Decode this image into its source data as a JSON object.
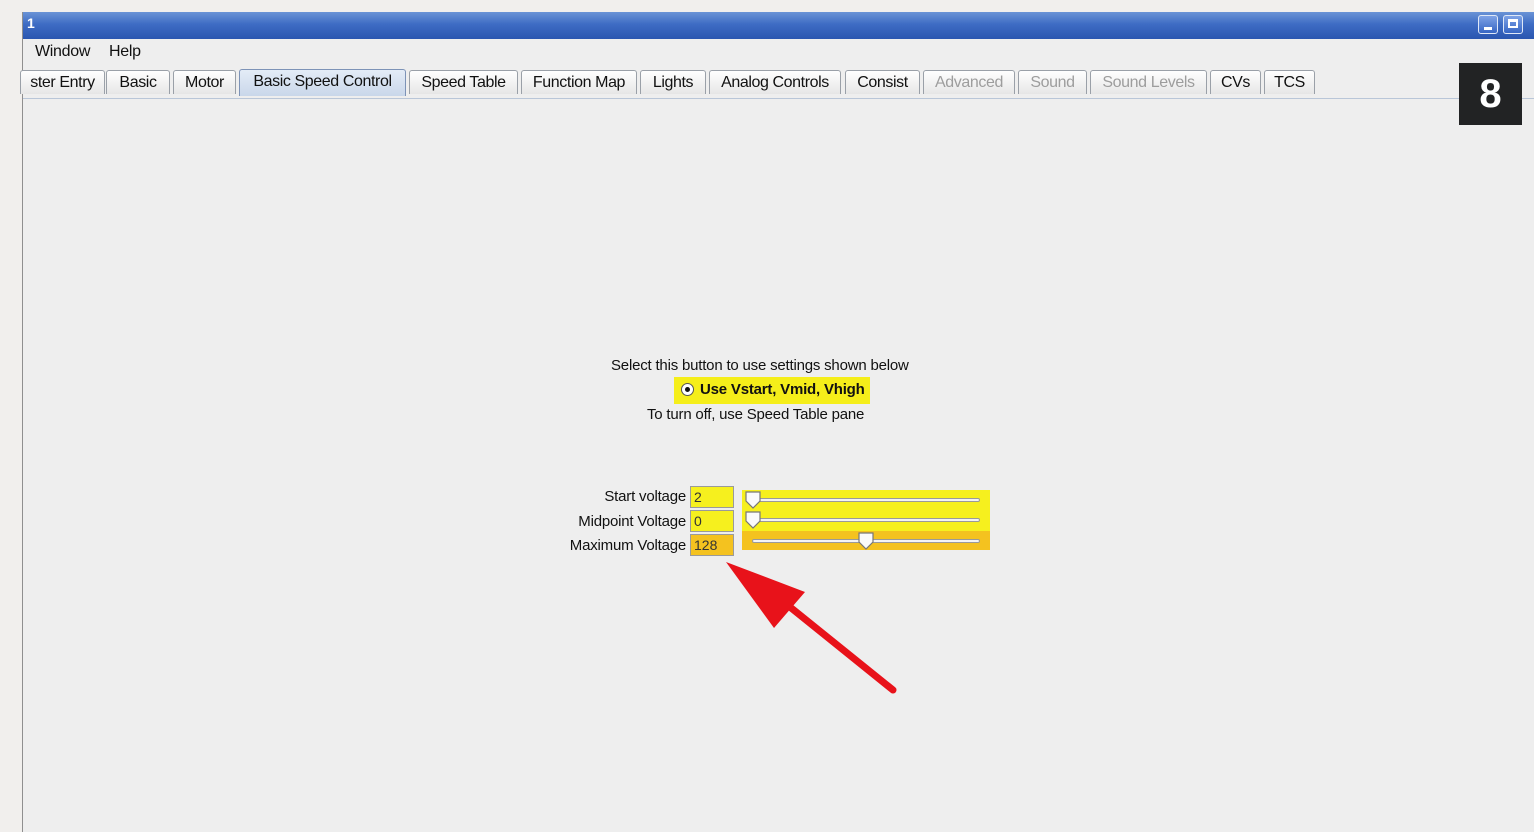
{
  "window": {
    "title": "1"
  },
  "menu": {
    "items": [
      "Window",
      "Help"
    ]
  },
  "tabs": [
    {
      "label": "ster Entry",
      "state": "normal"
    },
    {
      "label": "Basic",
      "state": "normal"
    },
    {
      "label": "Motor",
      "state": "normal"
    },
    {
      "label": "Basic Speed Control",
      "state": "selected"
    },
    {
      "label": "Speed Table",
      "state": "normal"
    },
    {
      "label": "Function Map",
      "state": "normal"
    },
    {
      "label": "Lights",
      "state": "normal"
    },
    {
      "label": "Analog Controls",
      "state": "normal"
    },
    {
      "label": "Consist",
      "state": "normal"
    },
    {
      "label": "Advanced",
      "state": "disabled"
    },
    {
      "label": "Sound",
      "state": "disabled"
    },
    {
      "label": "Sound Levels",
      "state": "disabled"
    },
    {
      "label": "CVs",
      "state": "normal"
    },
    {
      "label": "TCS",
      "state": "normal"
    }
  ],
  "badge": {
    "number": "8"
  },
  "panel": {
    "instruction": "Select this button to use settings shown below",
    "radio_label": "Use Vstart, Vmid, Vhigh",
    "radio_selected": true,
    "turn_off_note": "To turn off, use Speed Table pane"
  },
  "voltages": {
    "start": {
      "label": "Start voltage",
      "value": "2",
      "slider_fraction": 0.0
    },
    "mid": {
      "label": "Midpoint Voltage",
      "value": "0",
      "slider_fraction": 0.0
    },
    "max": {
      "label": "Maximum Voltage",
      "value": "128",
      "slider_fraction": 0.5
    }
  },
  "colors": {
    "highlight_yellow": "#f6f01e",
    "highlight_orange": "#f4c21f",
    "arrow_red": "#e8121a",
    "titlebar_blue": "#3e6cc4"
  },
  "annotation": {
    "arrow_icon": "red-arrow-icon"
  }
}
